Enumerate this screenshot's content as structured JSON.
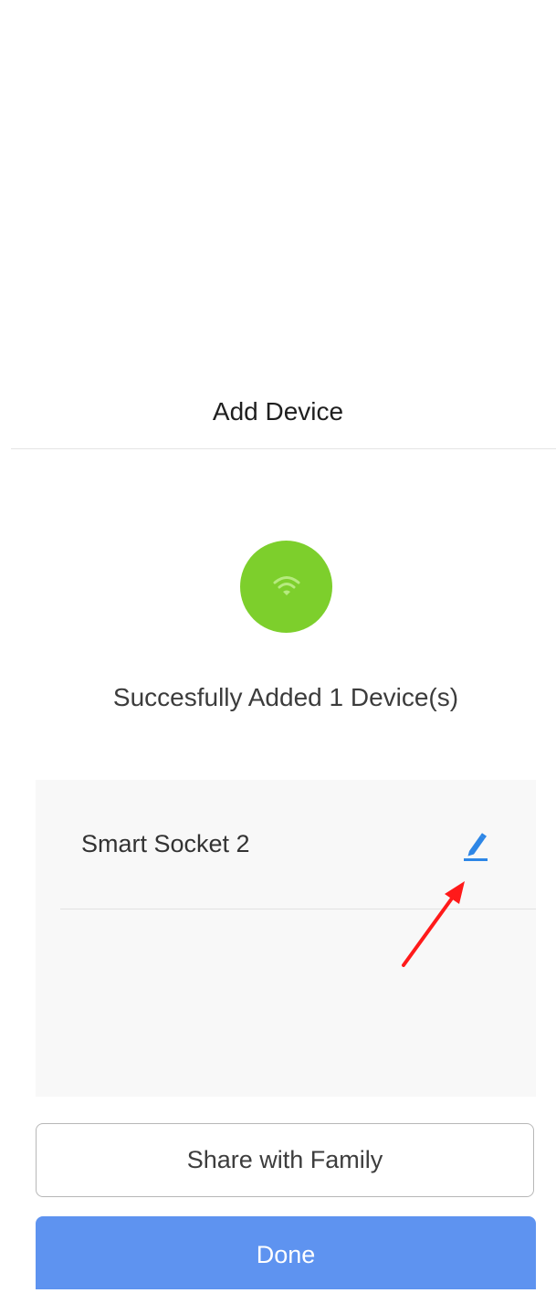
{
  "header": {
    "title": "Add Device"
  },
  "status": {
    "icon": "wifi-icon",
    "icon_background": "#7dcf2c",
    "message": "Succesfully Added 1 Device(s)"
  },
  "devices": [
    {
      "name": "Smart Socket 2",
      "edit_icon": "pencil-icon"
    }
  ],
  "annotation": {
    "icon": "red-arrow",
    "color": "#ff1a1a"
  },
  "actions": {
    "share_label": "Share with Family",
    "done_label": "Done",
    "done_color": "#5e93f0"
  }
}
